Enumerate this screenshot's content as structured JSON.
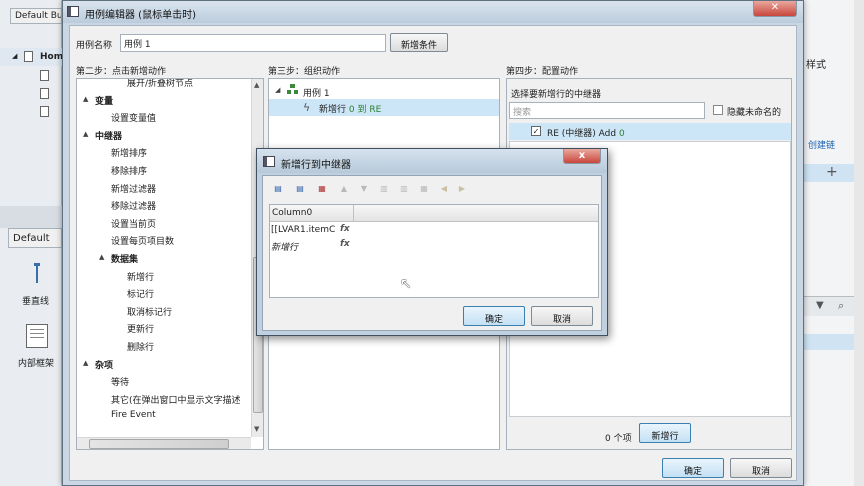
{
  "background": {
    "top_left_tab": "Default Butt",
    "default_tab": "Default",
    "home_label": "Hom",
    "vline_label": "垂直线",
    "inner_frame_label": "内部框架",
    "style_label": "样式",
    "create_link": "创建链",
    "plus": "+"
  },
  "dialog": {
    "title": "用例编辑器 (鼠标单击时)",
    "case_name_label": "用例名称",
    "case_name_value": "用例 1",
    "add_condition_button": "新增条件",
    "step2_title": "第二步：点击新增动作",
    "step3_title": "第三步：组织动作",
    "step4_title": "第四步：配置动作",
    "step2_tree": [
      {
        "label": "展开/折叠树节点",
        "level": 3,
        "bold": false
      },
      {
        "label": "变量",
        "level": 1,
        "bold": true,
        "expand": "▲"
      },
      {
        "label": "设置变量值",
        "level": 2,
        "bold": false
      },
      {
        "label": "中继器",
        "level": 1,
        "bold": true,
        "expand": "▲"
      },
      {
        "label": "新增排序",
        "level": 2,
        "bold": false
      },
      {
        "label": "移除排序",
        "level": 2,
        "bold": false
      },
      {
        "label": "新增过滤器",
        "level": 2,
        "bold": false
      },
      {
        "label": "移除过滤器",
        "level": 2,
        "bold": false
      },
      {
        "label": "设置当前页",
        "level": 2,
        "bold": false
      },
      {
        "label": "设置每页项目数",
        "level": 2,
        "bold": false
      },
      {
        "label": "数据集",
        "level": 2,
        "bold": true,
        "expand": "▲"
      },
      {
        "label": "新增行",
        "level": 3,
        "bold": false
      },
      {
        "label": "标记行",
        "level": 3,
        "bold": false
      },
      {
        "label": "取消标记行",
        "level": 3,
        "bold": false
      },
      {
        "label": "更新行",
        "level": 3,
        "bold": false
      },
      {
        "label": "删除行",
        "level": 3,
        "bold": false
      },
      {
        "label": "杂项",
        "level": 1,
        "bold": true,
        "expand": "▲"
      },
      {
        "label": "等待",
        "level": 2,
        "bold": false
      },
      {
        "label": "其它(在弹出窗口中显示文字描述",
        "level": 2,
        "bold": false
      },
      {
        "label": "Fire Event",
        "level": 2,
        "bold": false
      }
    ],
    "step3_case": "用例 1",
    "step3_action_prefix": "新增行 ",
    "step3_action_detail": "0 到 RE",
    "step4_select_label": "选择要新增行的中继器",
    "search_placeholder": "搜索",
    "hide_unnamed_label": "隐藏未命名的",
    "repeater_item_name": "RE (中继器) Add ",
    "repeater_item_count": "0",
    "items_count": "0 个项",
    "add_row_button": "新增行",
    "ok_button": "确定",
    "cancel_button": "取消"
  },
  "subdialog": {
    "title": "新增行到中继器",
    "close_icon": "x",
    "column_header": "Column0",
    "rows": [
      {
        "value": "[[LVAR1.itemC",
        "fx": "fx"
      },
      {
        "value": "新增行",
        "fx": "fx"
      }
    ],
    "ok_button": "确定",
    "cancel_button": "取消"
  },
  "colors": {
    "selected_row": "#cde6f7",
    "primary_border": "#3c7fb1",
    "close_red": "#c9463d"
  }
}
